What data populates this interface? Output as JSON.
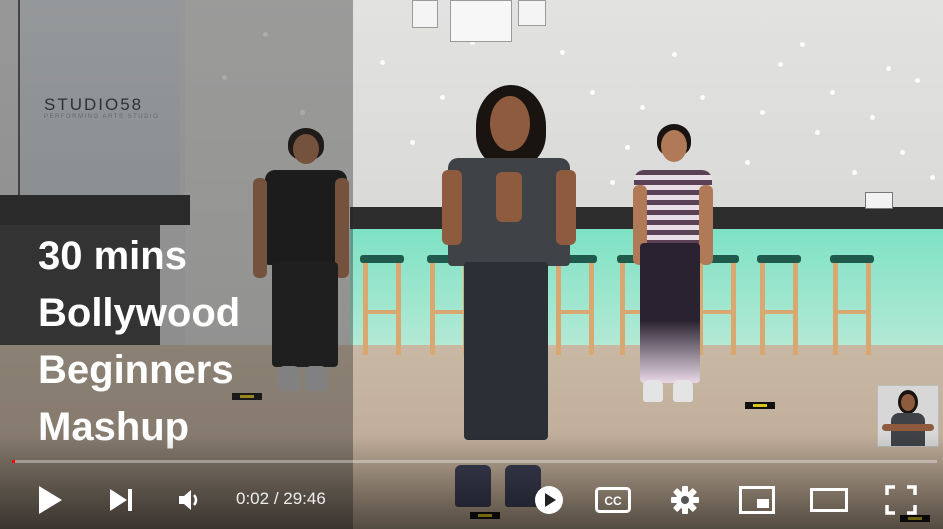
{
  "video": {
    "title_lines": [
      "30 mins",
      "Bollywood",
      "Beginners",
      "Mashup"
    ],
    "studio_logo": "STUDIO58",
    "studio_tagline": "PERFORMING ARTS STUDIO"
  },
  "player": {
    "current_time": "0:02",
    "separator": " / ",
    "duration": "29:46",
    "progress_fraction": 0.0011,
    "cc_label": "CC",
    "accent_color": "#ff0000"
  },
  "controls": {
    "icons": [
      "play-icon",
      "skip-next-icon",
      "volume-icon",
      "miniplayer-play-icon",
      "captions-icon",
      "settings-gear-icon",
      "miniplayer-icon",
      "theater-mode-icon",
      "fullscreen-icon"
    ]
  }
}
